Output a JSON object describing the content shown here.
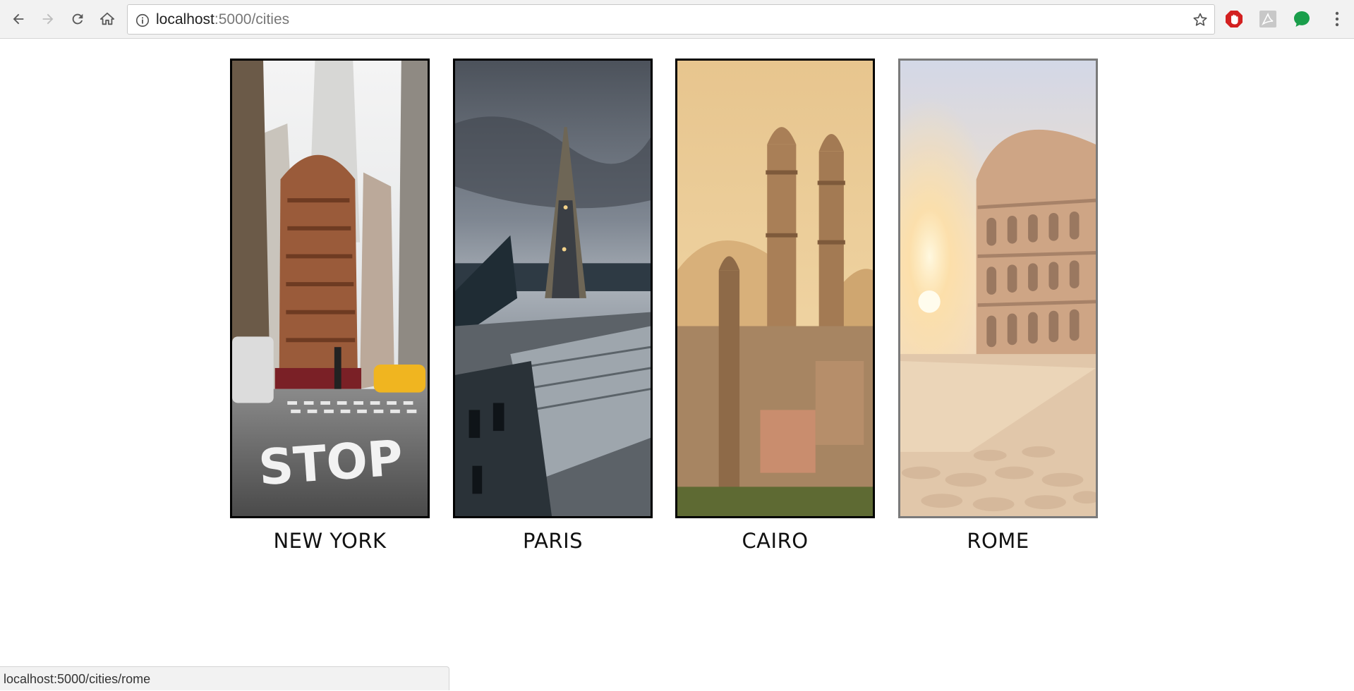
{
  "browser": {
    "url_host": "localhost",
    "url_rest": ":5000/cities",
    "status_url": "localhost:5000/cities/rome"
  },
  "cities": [
    {
      "name": "NEW YORK",
      "state": "normal"
    },
    {
      "name": "PARIS",
      "state": "normal"
    },
    {
      "name": "CAIRO",
      "state": "normal"
    },
    {
      "name": "ROME",
      "state": "hover"
    }
  ],
  "colors": {
    "frame_border": "#000000",
    "frame_border_hover": "#7a7a7a",
    "extension_red": "#d32020",
    "extension_green": "#1a9e4b"
  },
  "icons": {
    "back": "back-arrow-icon",
    "forward": "forward-arrow-icon",
    "reload": "reload-icon",
    "home": "home-icon",
    "site_info": "info-icon",
    "bookmark": "star-icon",
    "menu": "kebab-menu-icon"
  }
}
